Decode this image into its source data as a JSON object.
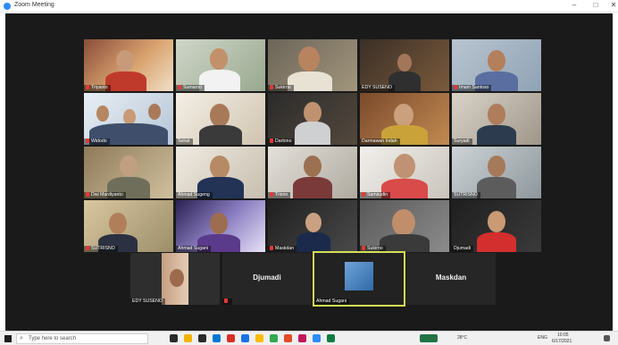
{
  "window": {
    "title": "Zoom Meeting"
  },
  "tiles": [
    {
      "name": "Djumadi"
    },
    {
      "name": "Maskdan"
    },
    {
      "name": "Ahmad Sugani"
    },
    {
      "name": "EDY SUSENO"
    },
    {
      "name": "Sehat"
    },
    {
      "name": "SUTRISNO"
    },
    {
      "name": "Widodo"
    },
    {
      "name": "Samsudin"
    },
    {
      "name": "Triyanto"
    },
    {
      "name": "Dwi Mardiyanto"
    },
    {
      "name": "Sumarno"
    },
    {
      "name": "Ahmad Sugeng"
    },
    {
      "name": "Dartono"
    },
    {
      "name": "Sukirno"
    },
    {
      "name": "Darmawan Indah"
    },
    {
      "name": "Suryadi"
    },
    {
      "name": "Imam Santoso"
    },
    {
      "name": "Trisno"
    }
  ],
  "taskbar": {
    "search_placeholder": "Type here to search",
    "temp": "28°C",
    "lang": "ENG",
    "time": "10:05",
    "date": "6/17/2021"
  }
}
